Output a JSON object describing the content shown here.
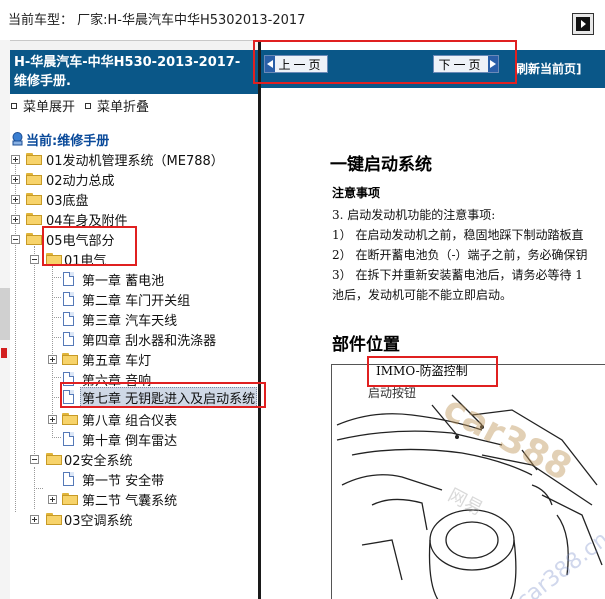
{
  "top_bar": {
    "title": "当前车型： 厂家:H-华晨汽车中华H5302013-2017"
  },
  "left_panel": {
    "manual_header": "H-华晨汽车-中华H530-2013-2017- 维修手册.",
    "menu_expand": "菜单展开",
    "menu_collapse": "菜单折叠",
    "current_label": "当前:维修手册",
    "tree": [
      {
        "label": "01发动机管理系统（ME788）"
      },
      {
        "label": "02动力总成"
      },
      {
        "label": "03底盘"
      },
      {
        "label": "04车身及附件"
      },
      {
        "label": "05电气部分"
      },
      {
        "label": "01电气"
      },
      {
        "label": "第一章 蓄电池"
      },
      {
        "label": "第二章 车门开关组"
      },
      {
        "label": "第三章 汽车天线"
      },
      {
        "label": "第四章 刮水器和洗涤器"
      },
      {
        "label": "第五章 车灯"
      },
      {
        "label": "第六章 音响"
      },
      {
        "label": "第七章 无钥匙进入及启动系统"
      },
      {
        "label": "第八章 组合仪表"
      },
      {
        "label": "第十章 倒车雷达"
      },
      {
        "label": "02安全系统"
      },
      {
        "label": "第一节 安全带"
      },
      {
        "label": "第二节 气囊系统"
      },
      {
        "label": "03空调系统"
      }
    ]
  },
  "right_panel": {
    "prev_label": "上一页",
    "next_label": "下一页",
    "refresh_label": "刷新当前页]",
    "doc_title": "一键启动系统",
    "notes_heading": "注意事项",
    "notes": [
      "3.  启动发动机功能的注意事项:",
      "1） 在启动发动机之前，稳固地踩下制动踏板直",
      "2） 在断开蓄电池负（-）端子之前，务必确保钥",
      "3） 在拆下并重新安装蓄电池后，请务必等待 1",
      "     池后，发动机可能不能立即启动。"
    ],
    "parts_heading": "部件位置",
    "figure_label_1": "IMMO-防盗控制",
    "figure_label_2": "启动按钮",
    "watermark_1": "car388",
    "watermark_2": "car388.cn",
    "watermark_3": "网易"
  },
  "colors": {
    "header_blue": "#0a5788",
    "annotation_red": "#e02020",
    "selected_bg": "#cfd8e6"
  }
}
